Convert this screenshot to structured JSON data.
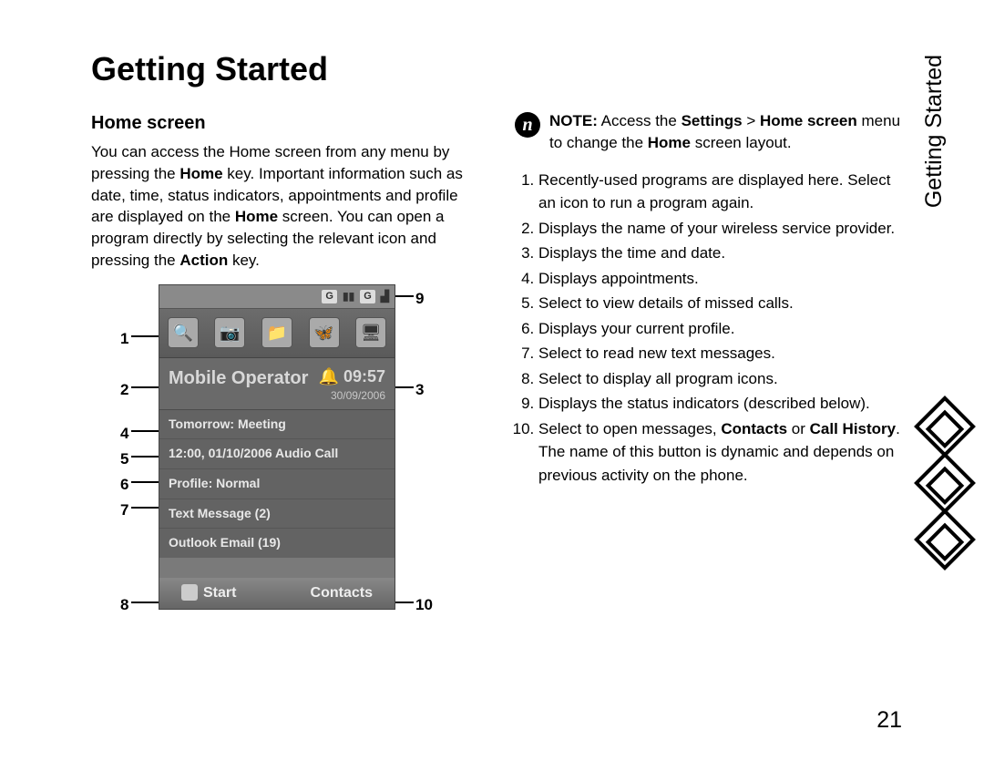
{
  "title": "Getting Started",
  "side_tab": "Getting Started",
  "page_number": "21",
  "left": {
    "subhead": "Home screen",
    "intro_parts": {
      "p1": "You can access the Home screen from any menu by pressing the ",
      "b1": "Home",
      "p2": " key. Important information such as date, time, status indicators, appointments and profile are displayed on the ",
      "b2": "Home",
      "p3": " screen. You can open a program directly by selecting the relevant icon and pressing the ",
      "b3": "Action",
      "p4": " key."
    }
  },
  "note": {
    "label": "NOTE:",
    "p1": " Access the ",
    "b1": "Settings",
    "gt": " > ",
    "b2": "Home screen",
    "p2": " menu to change the ",
    "b3": "Home",
    "p3": " screen layout."
  },
  "callouts": {
    "i1": "Recently-used programs are displayed here. Select an icon to run a program again.",
    "i2": "Displays the name of your wireless service provider.",
    "i3": "Displays the time and date.",
    "i4": "Displays appointments.",
    "i5": "Select to view details of missed calls.",
    "i6": "Displays your current profile.",
    "i7": "Select to read new text messages.",
    "i8": "Select to display all program icons.",
    "i9": "Displays the status indicators (described below).",
    "i10a": "Select to open messages, ",
    "i10b1": "Contacts",
    "i10mid": " or ",
    "i10b2": "Call History",
    "i10c": ". The name of this button is dynamic and depends on previous activity on the phone."
  },
  "phone": {
    "status_g1": "G",
    "status_g2": "G",
    "operator": "Mobile Operator",
    "bell": "🔔",
    "time": "09:57",
    "date": "30/09/2006",
    "line_appt": "Tomorrow: Meeting",
    "line_call": "12:00, 01/10/2006 Audio Call",
    "line_profile": "Profile: Normal",
    "line_sms": "Text Message (2)",
    "line_email": "Outlook Email (19)",
    "soft_left": "Start",
    "soft_right": "Contacts"
  },
  "labels": {
    "n1": "1",
    "n2": "2",
    "n3": "3",
    "n4": "4",
    "n5": "5",
    "n6": "6",
    "n7": "7",
    "n8": "8",
    "n9": "9",
    "n10": "10"
  }
}
